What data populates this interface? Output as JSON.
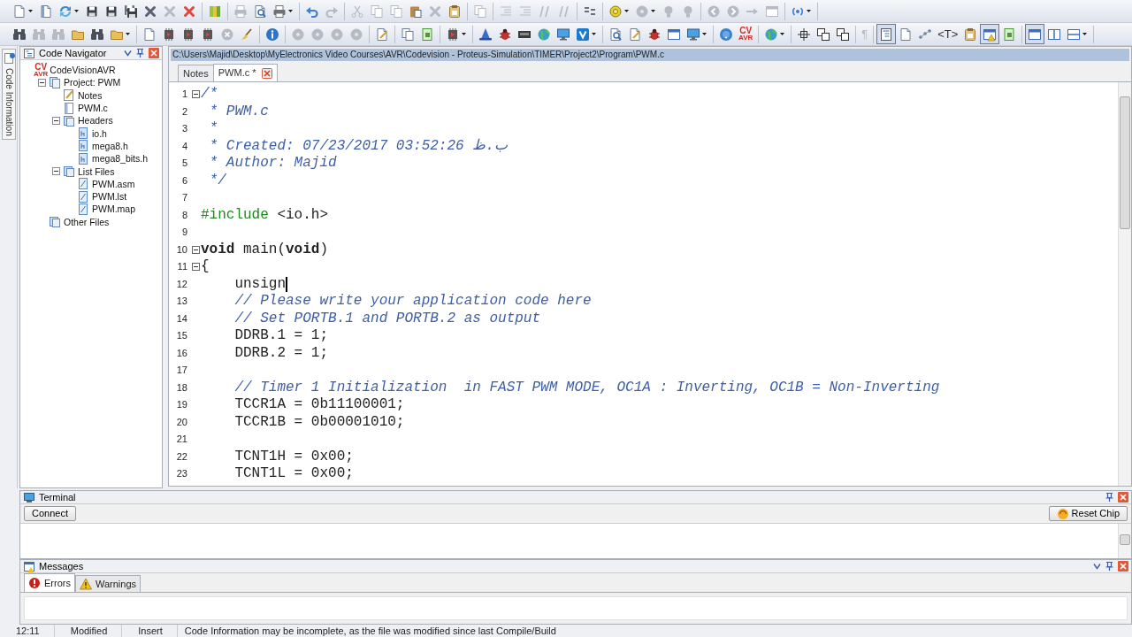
{
  "toolbars": [
    [
      [
        {
          "kind": "doc",
          "disabled": false,
          "dropdown": true,
          "pressed": false
        },
        {
          "kind": "docopen",
          "disabled": false,
          "dropdown": false,
          "pressed": false
        },
        {
          "kind": "refresh",
          "disabled": false,
          "dropdown": true,
          "pressed": false
        },
        {
          "kind": "save",
          "disabled": false,
          "dropdown": false,
          "pressed": false
        },
        {
          "kind": "save",
          "disabled": false,
          "dropdown": false,
          "pressed": false
        },
        {
          "kind": "saveall",
          "disabled": false,
          "dropdown": false,
          "pressed": false
        },
        {
          "kind": "close",
          "disabled": false,
          "dropdown": false,
          "pressed": false
        },
        {
          "kind": "close",
          "disabled": true,
          "dropdown": false,
          "pressed": false
        },
        {
          "kind": "delete",
          "disabled": false,
          "dropdown": false,
          "pressed": false
        }
      ],
      [
        {
          "kind": "books",
          "disabled": false,
          "dropdown": false,
          "pressed": false
        }
      ],
      [
        {
          "kind": "printer",
          "disabled": true,
          "dropdown": false,
          "pressed": false
        },
        {
          "kind": "preview",
          "disabled": false,
          "dropdown": false,
          "pressed": false
        },
        {
          "kind": "printer",
          "disabled": false,
          "dropdown": true,
          "pressed": false
        }
      ],
      [
        {
          "kind": "undo",
          "disabled": false,
          "dropdown": false,
          "pressed": false
        },
        {
          "kind": "redo",
          "disabled": true,
          "dropdown": false,
          "pressed": false
        }
      ],
      [
        {
          "kind": "cut",
          "disabled": true,
          "dropdown": false,
          "pressed": false
        },
        {
          "kind": "copy",
          "disabled": true,
          "dropdown": false,
          "pressed": false
        },
        {
          "kind": "copy",
          "disabled": true,
          "dropdown": false,
          "pressed": false
        },
        {
          "kind": "paste",
          "disabled": false,
          "dropdown": false,
          "pressed": false
        },
        {
          "kind": "close",
          "disabled": true,
          "dropdown": false,
          "pressed": false
        },
        {
          "kind": "clipboard",
          "disabled": false,
          "dropdown": false,
          "pressed": false
        }
      ],
      [
        {
          "kind": "copy",
          "disabled": true,
          "dropdown": false,
          "pressed": false
        }
      ],
      [
        {
          "kind": "indent",
          "disabled": true,
          "dropdown": false,
          "pressed": false
        },
        {
          "kind": "indent",
          "disabled": true,
          "dropdown": false,
          "pressed": false
        },
        {
          "kind": "comment",
          "disabled": true,
          "dropdown": false,
          "pressed": false
        },
        {
          "kind": "comment",
          "disabled": true,
          "dropdown": false,
          "pressed": false
        }
      ],
      [
        {
          "kind": "format",
          "disabled": false,
          "dropdown": false,
          "pressed": false
        }
      ],
      [
        {
          "kind": "disc",
          "disabled": false,
          "dropdown": true,
          "pressed": false
        },
        {
          "kind": "disc",
          "disabled": true,
          "dropdown": true,
          "pressed": false
        },
        {
          "kind": "bulb",
          "disabled": true,
          "dropdown": false,
          "pressed": false
        },
        {
          "kind": "bulb",
          "disabled": true,
          "dropdown": false,
          "pressed": false
        }
      ],
      [
        {
          "kind": "back",
          "disabled": true,
          "dropdown": false,
          "pressed": false
        },
        {
          "kind": "forward",
          "disabled": true,
          "dropdown": false,
          "pressed": false
        },
        {
          "kind": "arrow",
          "disabled": true,
          "dropdown": false,
          "pressed": false
        },
        {
          "kind": "window",
          "disabled": true,
          "dropdown": false,
          "pressed": false
        }
      ],
      [
        {
          "kind": "broadcast",
          "disabled": false,
          "dropdown": true,
          "pressed": false
        }
      ]
    ],
    [
      [
        {
          "kind": "binoculars",
          "disabled": false,
          "dropdown": false,
          "pressed": false
        },
        {
          "kind": "binoculars",
          "disabled": true,
          "dropdown": false,
          "pressed": false
        },
        {
          "kind": "binoculars",
          "disabled": true,
          "dropdown": false,
          "pressed": false
        },
        {
          "kind": "folder",
          "disabled": false,
          "dropdown": false,
          "pressed": false
        },
        {
          "kind": "binoculars",
          "disabled": false,
          "dropdown": false,
          "pressed": false
        },
        {
          "kind": "folder",
          "disabled": false,
          "dropdown": true,
          "pressed": false
        }
      ],
      [
        {
          "kind": "doc",
          "disabled": false,
          "dropdown": false,
          "pressed": false
        },
        {
          "kind": "chip",
          "disabled": false,
          "dropdown": false,
          "pressed": false
        },
        {
          "kind": "chip",
          "disabled": false,
          "dropdown": false,
          "pressed": false
        },
        {
          "kind": "chip",
          "disabled": false,
          "dropdown": false,
          "pressed": false
        },
        {
          "kind": "stop",
          "disabled": true,
          "dropdown": false,
          "pressed": false
        },
        {
          "kind": "broom",
          "disabled": false,
          "dropdown": false,
          "pressed": false
        }
      ],
      [
        {
          "kind": "info",
          "disabled": false,
          "dropdown": false,
          "pressed": false
        }
      ],
      [
        {
          "kind": "disc",
          "disabled": true,
          "dropdown": false,
          "pressed": false
        },
        {
          "kind": "disc",
          "disabled": true,
          "dropdown": false,
          "pressed": false
        },
        {
          "kind": "disc",
          "disabled": true,
          "dropdown": false,
          "pressed": false
        },
        {
          "kind": "disc",
          "disabled": true,
          "dropdown": false,
          "pressed": false
        }
      ],
      [
        {
          "kind": "note",
          "disabled": false,
          "dropdown": false,
          "pressed": false
        }
      ],
      [
        {
          "kind": "copy",
          "disabled": false,
          "dropdown": false,
          "pressed": false
        },
        {
          "kind": "page",
          "disabled": false,
          "dropdown": false,
          "pressed": false
        }
      ],
      [
        {
          "kind": "chip",
          "disabled": false,
          "dropdown": true,
          "pressed": false
        }
      ],
      [
        {
          "kind": "wizard",
          "disabled": false,
          "dropdown": false,
          "pressed": false
        },
        {
          "kind": "bug",
          "disabled": false,
          "dropdown": false,
          "pressed": false
        },
        {
          "kind": "memory",
          "disabled": false,
          "dropdown": false,
          "pressed": false
        },
        {
          "kind": "globe",
          "disabled": false,
          "dropdown": false,
          "pressed": false
        },
        {
          "kind": "monitor",
          "disabled": false,
          "dropdown": false,
          "pressed": false
        },
        {
          "kind": "chevron",
          "disabled": false,
          "dropdown": true,
          "pressed": false
        }
      ],
      [
        {
          "kind": "preview",
          "disabled": false,
          "dropdown": false,
          "pressed": false
        },
        {
          "kind": "note",
          "disabled": false,
          "dropdown": false,
          "pressed": false
        },
        {
          "kind": "bug",
          "disabled": false,
          "dropdown": false,
          "pressed": false
        },
        {
          "kind": "window",
          "disabled": false,
          "dropdown": false,
          "pressed": false
        },
        {
          "kind": "monitor",
          "disabled": false,
          "dropdown": true,
          "pressed": false
        }
      ],
      [
        {
          "kind": "help",
          "disabled": false,
          "dropdown": false,
          "pressed": false
        },
        {
          "kind": "logo",
          "top": "CV",
          "bottom": "AVR",
          "disabled": false,
          "dropdown": false,
          "pressed": false
        }
      ],
      [
        {
          "kind": "globe",
          "disabled": false,
          "dropdown": true,
          "pressed": false
        }
      ],
      [
        {
          "kind": "crosshair",
          "disabled": false,
          "dropdown": false,
          "pressed": false
        },
        {
          "kind": "arrange",
          "disabled": false,
          "dropdown": false,
          "pressed": false
        },
        {
          "kind": "arrange",
          "disabled": false,
          "dropdown": false,
          "pressed": false
        }
      ],
      [
        {
          "kind": "glyph",
          "text": "¶",
          "disabled": true,
          "dropdown": false,
          "pressed": false
        }
      ],
      [
        {
          "kind": "outline",
          "disabled": false,
          "dropdown": false,
          "pressed": true
        },
        {
          "kind": "doc",
          "disabled": false,
          "dropdown": false,
          "pressed": false
        },
        {
          "kind": "diagram",
          "disabled": false,
          "dropdown": false,
          "pressed": false
        },
        {
          "kind": "glyph",
          "text": "<T>",
          "disabled": false,
          "dropdown": false,
          "pressed": false
        },
        {
          "kind": "clipboard",
          "disabled": false,
          "dropdown": false,
          "pressed": false
        },
        {
          "kind": "windowalert",
          "disabled": false,
          "dropdown": false,
          "pressed": true
        },
        {
          "kind": "page",
          "disabled": false,
          "dropdown": false,
          "pressed": false
        }
      ],
      [
        {
          "kind": "window",
          "disabled": false,
          "dropdown": false,
          "pressed": true
        },
        {
          "kind": "splitv",
          "disabled": false,
          "dropdown": false,
          "pressed": false
        },
        {
          "kind": "splith",
          "disabled": false,
          "dropdown": true,
          "pressed": false
        }
      ]
    ]
  ],
  "side_tab": {
    "label": "Code Information"
  },
  "navigator": {
    "title": "Code Navigator",
    "tree": [
      {
        "label": "CodeVisionAVR",
        "kind": "logo",
        "logo": {
          "top": "CV",
          "bottom": "AVR"
        },
        "children": [
          {
            "label": "Project: PWM",
            "kind": "project",
            "expanded": true,
            "children": [
              {
                "label": "Notes",
                "kind": "notes"
              },
              {
                "label": "PWM.c",
                "kind": "source"
              },
              {
                "label": "Headers",
                "kind": "folder",
                "expanded": true,
                "children": [
                  {
                    "label": "io.h",
                    "kind": "header"
                  },
                  {
                    "label": "mega8.h",
                    "kind": "header"
                  },
                  {
                    "label": "mega8_bits.h",
                    "kind": "header"
                  }
                ]
              },
              {
                "label": "List Files",
                "kind": "folder",
                "expanded": true,
                "children": [
                  {
                    "label": "PWM.asm",
                    "kind": "listing"
                  },
                  {
                    "label": "PWM.lst",
                    "kind": "listing"
                  },
                  {
                    "label": "PWM.map",
                    "kind": "listing"
                  }
                ]
              }
            ]
          },
          {
            "label": "Other Files",
            "kind": "folder"
          }
        ]
      }
    ]
  },
  "editor": {
    "path": "C:\\Users\\Majid\\Desktop\\MyElectronics Video Courses\\AVR\\Codevision - Proteus-Simulation\\TIMER\\Project2\\Program\\PWM.c",
    "tabs": [
      {
        "label": "Notes",
        "selected": false
      },
      {
        "label": "PWM.c *",
        "selected": true
      }
    ],
    "lines": [
      {
        "number": "1",
        "fold": true,
        "caret": false,
        "segments": [
          {
            "kind": "comment",
            "text": "/*"
          }
        ]
      },
      {
        "number": "2",
        "fold": false,
        "caret": false,
        "segments": [
          {
            "kind": "comment",
            "text": " * PWM.c"
          }
        ]
      },
      {
        "number": "3",
        "fold": false,
        "caret": false,
        "segments": [
          {
            "kind": "comment",
            "text": " *"
          }
        ]
      },
      {
        "number": "4",
        "fold": false,
        "caret": false,
        "segments": [
          {
            "kind": "comment",
            "text": " * Created: 07/23/2017 03:52:26 ب.ظ"
          }
        ]
      },
      {
        "number": "5",
        "fold": false,
        "caret": false,
        "segments": [
          {
            "kind": "comment",
            "text": " * Author: Majid"
          }
        ]
      },
      {
        "number": "6",
        "fold": false,
        "caret": false,
        "segments": [
          {
            "kind": "comment",
            "text": " */"
          }
        ]
      },
      {
        "number": "7",
        "fold": false,
        "caret": false
      },
      {
        "number": "8",
        "fold": false,
        "caret": false,
        "segments": [
          {
            "kind": "preprocessor",
            "text": "#include"
          },
          {
            "kind": "plain",
            "text": " <io.h>"
          }
        ]
      },
      {
        "number": "9",
        "fold": false,
        "caret": false
      },
      {
        "number": "10",
        "fold": true,
        "caret": false,
        "segments": [
          {
            "kind": "keyword",
            "text": "void"
          },
          {
            "kind": "plain",
            "text": " main("
          },
          {
            "kind": "keyword",
            "text": "void"
          },
          {
            "kind": "plain",
            "text": ")"
          }
        ]
      },
      {
        "number": "11",
        "fold": true,
        "caret": false,
        "segments": [
          {
            "kind": "plain",
            "text": "{"
          }
        ]
      },
      {
        "number": "12",
        "fold": false,
        "caret": true,
        "segments": [
          {
            "kind": "plain",
            "text": "    unsign"
          }
        ]
      },
      {
        "number": "13",
        "fold": false,
        "caret": false,
        "segments": [
          {
            "kind": "comment",
            "text": "    // Please write your application code here"
          }
        ]
      },
      {
        "number": "14",
        "fold": false,
        "caret": false,
        "segments": [
          {
            "kind": "comment",
            "text": "    // Set PORTB.1 and PORTB.2 as output"
          }
        ]
      },
      {
        "number": "15",
        "fold": false,
        "caret": false,
        "segments": [
          {
            "kind": "plain",
            "text": "    DDRB.1 = 1;"
          }
        ]
      },
      {
        "number": "16",
        "fold": false,
        "caret": false,
        "segments": [
          {
            "kind": "plain",
            "text": "    DDRB.2 = 1;"
          }
        ]
      },
      {
        "number": "17",
        "fold": false,
        "caret": false
      },
      {
        "number": "18",
        "fold": false,
        "caret": false,
        "segments": [
          {
            "kind": "comment",
            "text": "    // Timer 1 Initialization  in FAST PWM MODE, OC1A : Inverting, OC1B = Non-Inverting"
          }
        ]
      },
      {
        "number": "19",
        "fold": false,
        "caret": false,
        "segments": [
          {
            "kind": "plain",
            "text": "    TCCR1A = 0b11100001;"
          }
        ]
      },
      {
        "number": "20",
        "fold": false,
        "caret": false,
        "segments": [
          {
            "kind": "plain",
            "text": "    TCCR1B = 0b00001010;"
          }
        ]
      },
      {
        "number": "21",
        "fold": false,
        "caret": false
      },
      {
        "number": "22",
        "fold": false,
        "caret": false,
        "segments": [
          {
            "kind": "plain",
            "text": "    TCNT1H = 0x00;"
          }
        ]
      },
      {
        "number": "23",
        "fold": false,
        "caret": false,
        "segments": [
          {
            "kind": "plain",
            "text": "    TCNT1L = 0x00;"
          }
        ]
      }
    ]
  },
  "terminal": {
    "title": "Terminal",
    "connect_button": "Connect",
    "reset_button": "Reset Chip"
  },
  "messages": {
    "title": "Messages",
    "tabs": [
      {
        "label": "Errors",
        "kind": "error",
        "selected": true
      },
      {
        "label": "Warnings",
        "kind": "warning",
        "selected": false
      }
    ]
  },
  "status_bar": [
    "12:11",
    "Modified",
    "Insert",
    "Code Information may be incomplete, as the file was modified since last Compile/Build"
  ]
}
